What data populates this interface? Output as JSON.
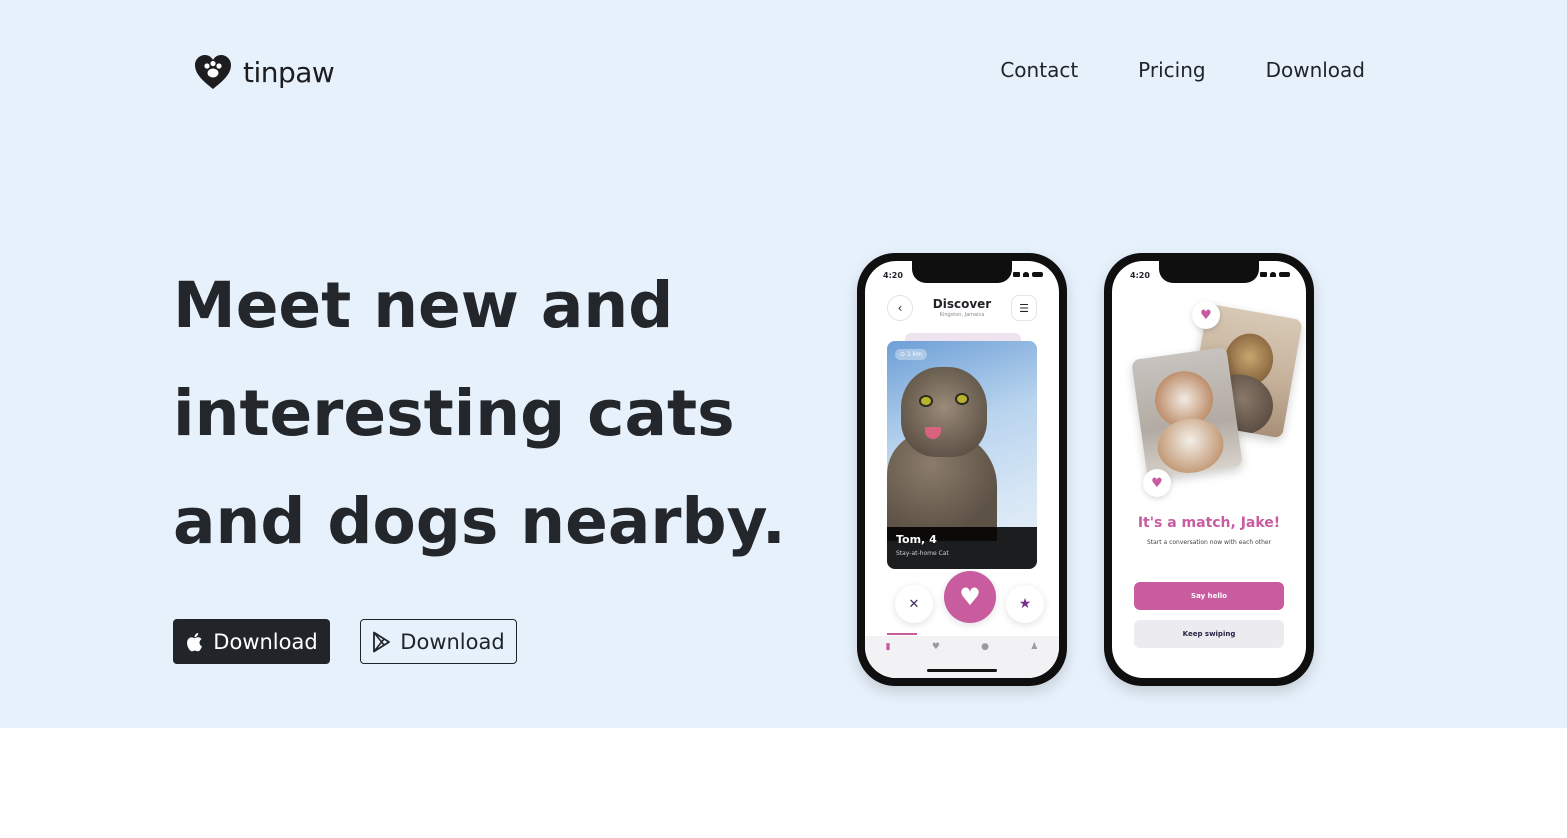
{
  "brand": {
    "name": "tinpaw",
    "icon": "paw-heart-icon"
  },
  "nav": {
    "items": [
      "Contact",
      "Pricing",
      "Download"
    ]
  },
  "hero": {
    "headline_lines": [
      "Meet new and",
      "interesting cats",
      "and dogs nearby."
    ],
    "buttons": {
      "apple": {
        "label": "Download",
        "icon": "apple-icon"
      },
      "play": {
        "label": "Download",
        "icon": "google-play-icon"
      }
    }
  },
  "phone1": {
    "time": "4:20",
    "title": "Discover",
    "subtitle": "Kingston, Jamaica",
    "distance": "1 km",
    "pet_name": "Tom, 4",
    "pet_desc": "Stay-at-home Cat",
    "actions": [
      "✕",
      "♥",
      "★"
    ]
  },
  "phone2": {
    "time": "4:20",
    "match_title": "It's a match, Jake!",
    "match_sub": "Start a conversation now with each other",
    "say_hello": "Say hello",
    "keep_swiping": "Keep swiping"
  },
  "colors": {
    "accent": "#c95b9f",
    "hero_bg": "#e7f1fb",
    "dark": "#212529"
  }
}
